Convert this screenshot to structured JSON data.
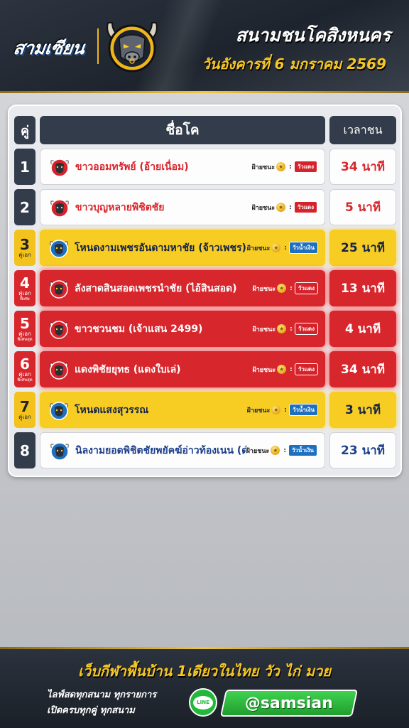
{
  "header": {
    "brand": "สามเซียน",
    "title": "สนามชนโคสิงหนคร",
    "date": "วันอังคารที่ 6 มกราคม 2569"
  },
  "table": {
    "headers": {
      "pair": "คู่",
      "name": "ชื่อโค",
      "time": "เวลาชน"
    },
    "winner_label": "ฝ้ายชนะ",
    "rows": [
      {
        "no": "1",
        "tag": "",
        "tag2": "",
        "name": "ขาวออมทรัพย์ (อ้ายเนื่อม)",
        "side": "วัวแดง",
        "time": "34 นาที",
        "style": "white",
        "side_color": "red"
      },
      {
        "no": "2",
        "tag": "",
        "tag2": "",
        "name": "ขาวบุญหลายพิชิตชัย",
        "side": "วัวแดง",
        "time": "5 นาที",
        "style": "white",
        "side_color": "red"
      },
      {
        "no": "3",
        "tag": "คู่เอก",
        "tag2": "",
        "name": "โหนดงามเพชรอันดามหาชัย (จ้าวเพชร)",
        "side": "วัวน้ำเงิน",
        "time": "25 นาที",
        "style": "yellow",
        "side_color": "blue"
      },
      {
        "no": "4",
        "tag": "คู่เอก",
        "tag2": "พิเศษ",
        "name": "ลังสาดสินสอดเพชรนำชัย (ไอ้สินสอด)",
        "side": "วัวแดง",
        "time": "13 นาที",
        "style": "red",
        "side_color": "red"
      },
      {
        "no": "5",
        "tag": "คู่เอก",
        "tag2": "พิเศษสุด",
        "name": "ขาวชวนชม (เจ้าแสน 2499)",
        "side": "วัวแดง",
        "time": "4 นาที",
        "style": "red",
        "side_color": "red"
      },
      {
        "no": "6",
        "tag": "คู่เอก",
        "tag2": "พิเศษสุด",
        "name": "แดงพิชัยยุทธ (แดงใบเล่)",
        "side": "วัวแดง",
        "time": "34 นาที",
        "style": "red",
        "side_color": "red"
      },
      {
        "no": "7",
        "tag": "คู่เอก",
        "tag2": "",
        "name": "โหนดแสงสุวรรณ",
        "side": "วัวน้ำเงิน",
        "time": "3 นาที",
        "style": "yellow",
        "side_color": "blue"
      },
      {
        "no": "8",
        "tag": "",
        "tag2": "",
        "name": "นิลงามยอดพิชิตชัยพยัคฆ์อ่าวท้องเนน (ดำด่าโอ)",
        "side": "วัวน้ำเงิน",
        "time": "23 นาที",
        "style": "white-blue",
        "side_color": "blue"
      }
    ]
  },
  "footer": {
    "slogan": "เว็บกีฬาพื้นบ้าน 1เดียวในไทย วัว ไก่ มวย",
    "line1": "ไลฟ์สดทุกสนาม ทุกรายการ",
    "line2": "เปิดครบทุกคู่ ทุกสนาม",
    "line_badge": "LINE",
    "line_id": "@samsian"
  },
  "colors": {
    "red": "#d8262d",
    "yellow": "#f7cd24",
    "navy": "#333c4a",
    "blue": "#1d6fc0",
    "gold": "#f6c624",
    "line_green": "#24b83b"
  },
  "icons": [
    "bull-head-icon",
    "coin-icon",
    "line-icon"
  ]
}
